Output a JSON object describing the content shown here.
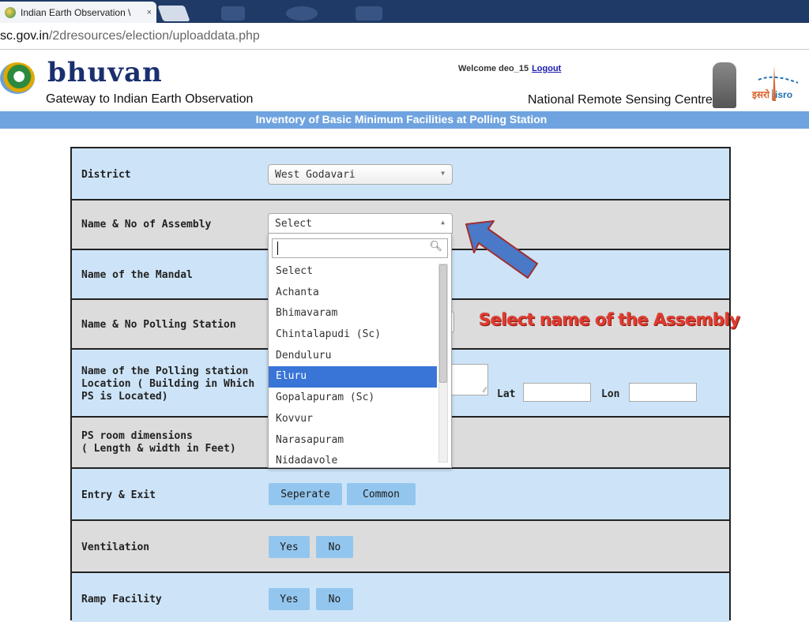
{
  "browser": {
    "tab_title": "Indian Earth Observation \\",
    "tab_close": "×",
    "url_domain": "sc.gov.in",
    "url_path": "/2dresources/election/uploaddata.php"
  },
  "header": {
    "logo_text": "bhuvan",
    "tagline": "Gateway to Indian Earth Observation",
    "welcome_text": "Welcome deo_15",
    "logout_label": "Logout",
    "org_name": "National Remote Sensing Centre",
    "isro_hindi": "इसरो",
    "isro_en": "isro"
  },
  "page_title": "Inventory of Basic Minimum Facilities at Polling Station",
  "form": {
    "district_label": "District",
    "district_value": "West Godavari",
    "assembly_label": "Name & No of Assembly",
    "assembly_value": "Select",
    "mandal_label": "Name of the Mandal",
    "polling_station_label": "Name & No Polling Station",
    "ps_location_label_1": "Name of the Polling station",
    "ps_location_label_2": "Location ( Building in Which",
    "ps_location_label_3": "PS is Located)",
    "lat_label": "Lat",
    "lon_label": "Lon",
    "room_label_1": "PS room dimensions",
    "room_label_2": "( Length & width in Feet)",
    "entry_label": "Entry & Exit",
    "entry_opt1": "Seperate",
    "entry_opt2": "Common",
    "ventilation_label": "Ventilation",
    "ramp_label": "Ramp Facility",
    "yes": "Yes",
    "no": "No"
  },
  "dropdown": {
    "options": [
      "Select",
      "Achanta",
      "Bhimavaram",
      "Chintalapudi (Sc)",
      "Denduluru",
      "Eluru",
      "Gopalapuram (Sc)",
      "Kovvur",
      "Narasapuram",
      "Nidadavole"
    ],
    "highlighted": "Eluru"
  },
  "annotation": "Select name of the Assembly",
  "colors": {
    "row_blue": "#cde4f8",
    "row_grey": "#dcdcdc",
    "title_bar": "#6fa3e0",
    "highlight": "#3875d7",
    "button": "#93c6ee",
    "annotation_red": "#e23a2e"
  }
}
